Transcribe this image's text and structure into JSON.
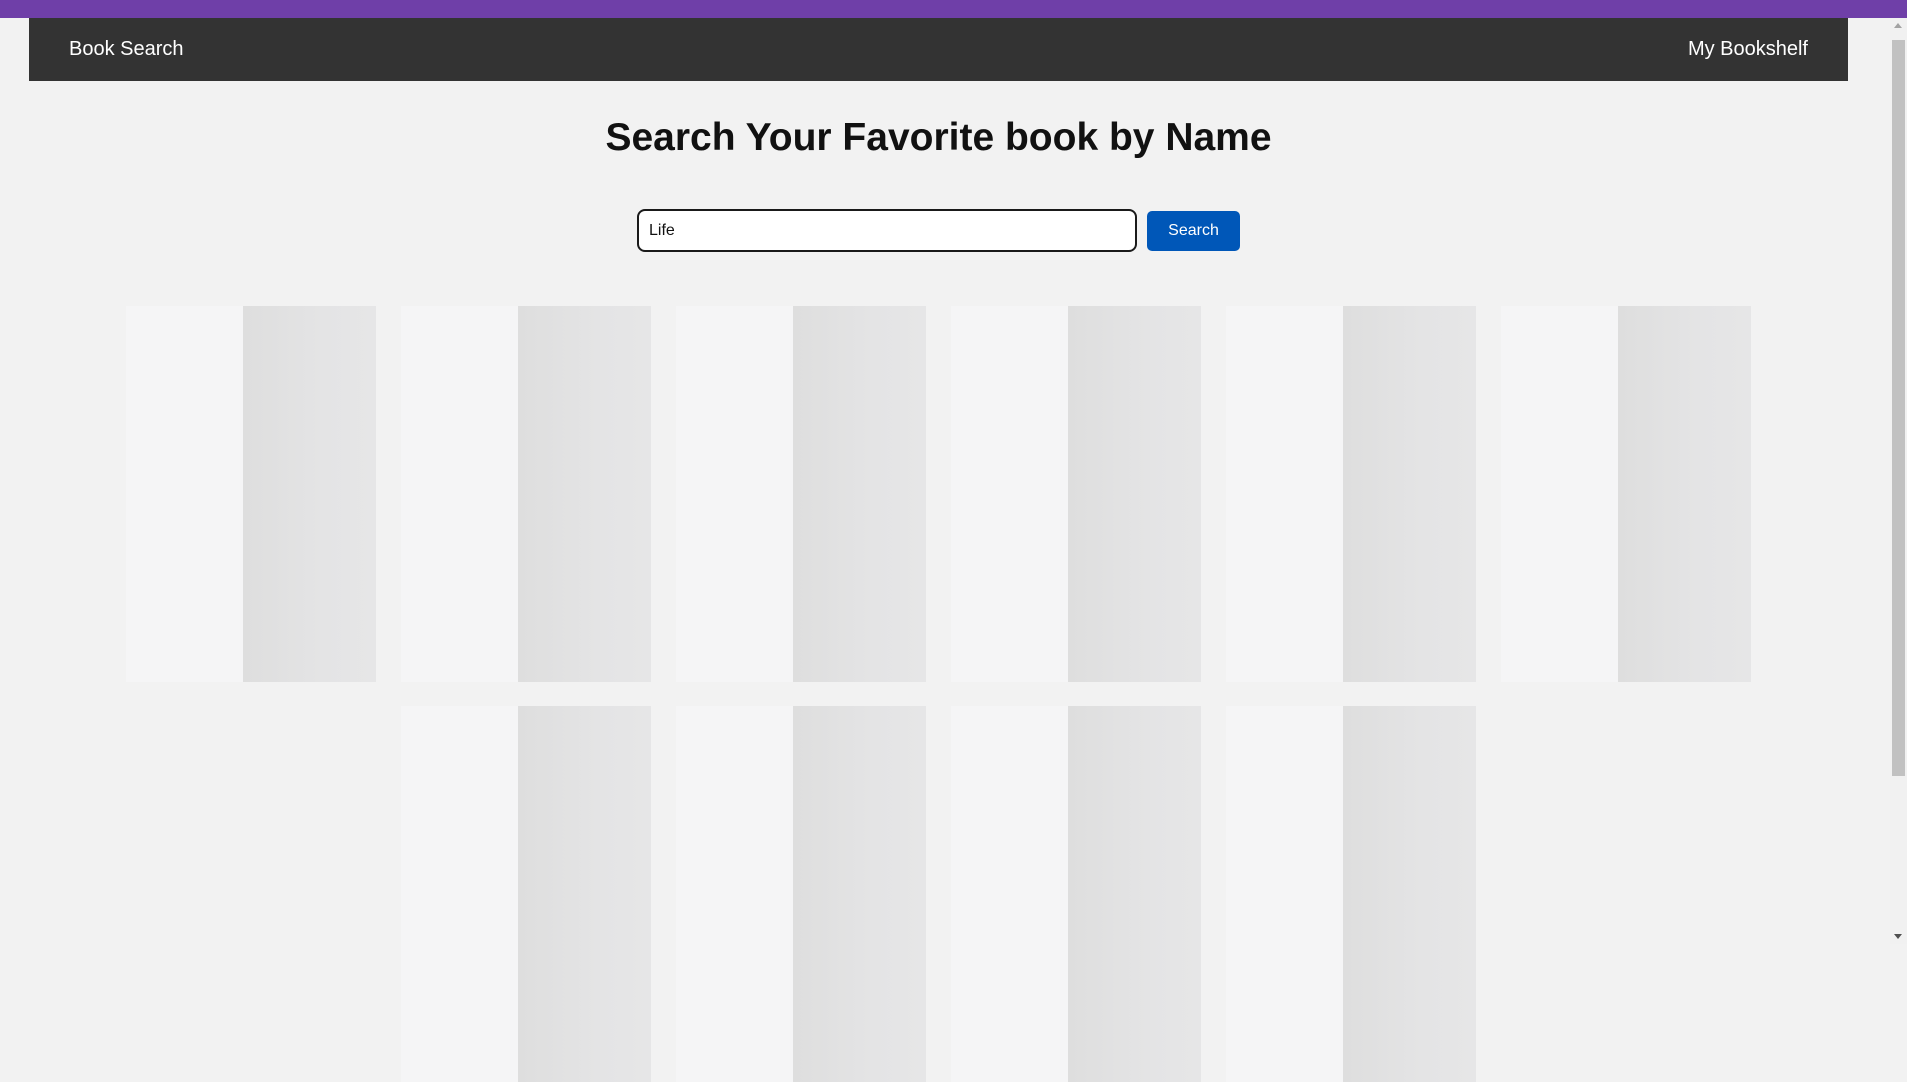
{
  "navbar": {
    "brand": "Book Search",
    "bookshelf_link": "My Bookshelf",
    "background_color": "#333333"
  },
  "main": {
    "title": "Search Your Favorite book by Name",
    "search": {
      "value": "Life",
      "button_label": "Search",
      "button_color": "#0057b8"
    },
    "results": {
      "state": "loading-skeleton",
      "rows": [
        6,
        4
      ]
    }
  },
  "browser": {
    "bookmarks_bar_color": "#6f3fa8"
  }
}
